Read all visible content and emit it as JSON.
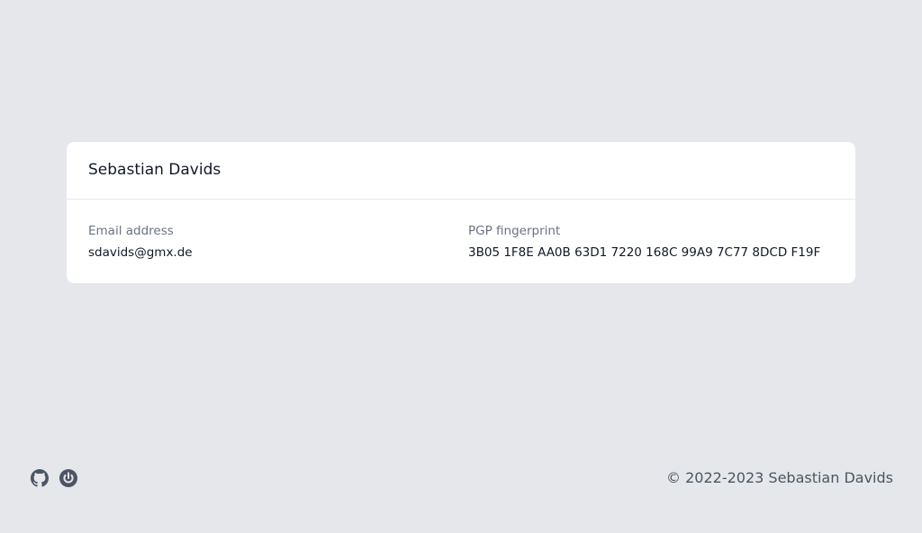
{
  "card": {
    "title": "Sebastian Davids",
    "email": {
      "label": "Email address",
      "value": "sdavids@gmx.de"
    },
    "pgp": {
      "label": "PGP fingerprint",
      "value": "3B05 1F8E AA0B 63D1 7220 168C 99A9 7C77 8DCD F19F"
    }
  },
  "footer": {
    "icons": [
      "github-icon",
      "power-icon"
    ],
    "icon_color": "#4b5563",
    "copyright": "© 2022-2023 Sebastian Davids"
  },
  "colors": {
    "background": "#e5e7eb",
    "card": "#ffffff"
  }
}
